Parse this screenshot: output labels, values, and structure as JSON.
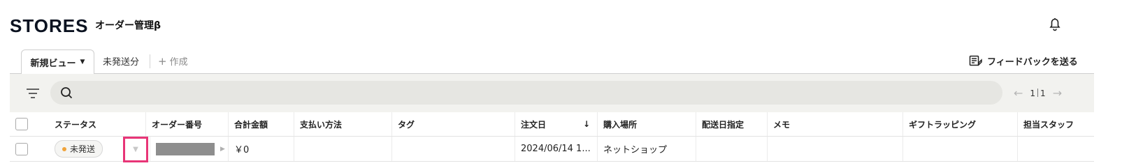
{
  "header": {
    "logo": "STORES",
    "app_title": "オーダー管理β"
  },
  "tabs": {
    "active": "新規ビュー",
    "items": [
      "未発送分"
    ],
    "create": "作成",
    "feedback": "フィードバックを送る"
  },
  "toolbar": {
    "search_placeholder": "",
    "pager_current": "1",
    "pager_total": "1"
  },
  "table": {
    "headers": [
      "ステータス",
      "オーダー番号",
      "合計金額",
      "支払い方法",
      "タグ",
      "注文日",
      "購入場所",
      "配送日指定",
      "メモ",
      "ギフトラッピング",
      "担当スタッフ"
    ],
    "sort_indicator": "↓",
    "rows": [
      {
        "status": "未発送",
        "order_number": "",
        "total": "￥0",
        "payment": "",
        "tag": "",
        "order_date": "2024/06/14 1...",
        "place": "ネットショップ",
        "delivery_date": "",
        "memo": "",
        "gift": "",
        "staff": ""
      }
    ]
  },
  "colors": {
    "status_dot": "#f0a33a",
    "highlight": "#e83577"
  },
  "icons": [
    "bell-icon",
    "filter-icon",
    "search-icon",
    "feedback-icon",
    "chevron-left-icon",
    "chevron-right-icon",
    "plus-icon"
  ]
}
